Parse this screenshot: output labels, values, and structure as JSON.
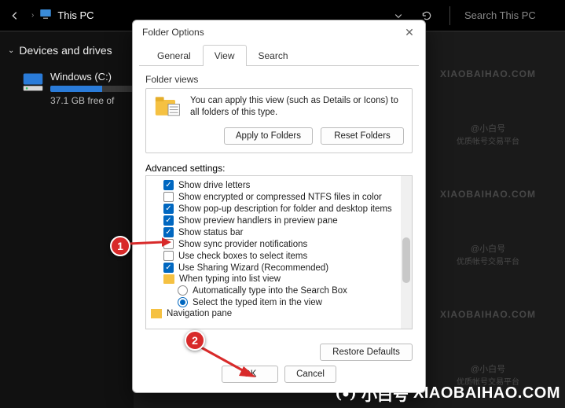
{
  "topbar": {
    "location": "This PC",
    "search_placeholder": "Search This PC"
  },
  "sidebar": {
    "section": "Devices and drives",
    "drive": {
      "name": "Windows (C:)",
      "sub": "37.1 GB free of",
      "fill_pct": 60
    }
  },
  "dialog": {
    "title": "Folder Options",
    "tabs": {
      "general": "General",
      "view": "View",
      "search": "Search"
    },
    "folder_views": {
      "heading": "Folder views",
      "text": "You can apply this view (such as Details or Icons) to all folders of this type.",
      "apply": "Apply to Folders",
      "reset": "Reset Folders"
    },
    "advanced": {
      "heading": "Advanced settings:",
      "items": [
        {
          "kind": "check",
          "checked": true,
          "label": "Show drive letters"
        },
        {
          "kind": "check",
          "checked": false,
          "label": "Show encrypted or compressed NTFS files in color"
        },
        {
          "kind": "check",
          "checked": true,
          "label": "Show pop-up description for folder and desktop items"
        },
        {
          "kind": "check",
          "checked": true,
          "label": "Show preview handlers in preview pane"
        },
        {
          "kind": "check",
          "checked": true,
          "label": "Show status bar"
        },
        {
          "kind": "check",
          "checked": false,
          "label": "Show sync provider notifications"
        },
        {
          "kind": "check",
          "checked": false,
          "label": "Use check boxes to select items"
        },
        {
          "kind": "check",
          "checked": true,
          "label": "Use Sharing Wizard (Recommended)"
        },
        {
          "kind": "folder",
          "label": "When typing into list view"
        },
        {
          "kind": "radio",
          "selected": false,
          "label": "Automatically type into the Search Box"
        },
        {
          "kind": "radio",
          "selected": true,
          "label": "Select the typed item in the view"
        },
        {
          "kind": "pane",
          "label": "Navigation pane"
        }
      ]
    },
    "restore": "Restore Defaults",
    "ok": "OK",
    "cancel": "Cancel"
  },
  "markers": {
    "m1": "1",
    "m2": "2"
  },
  "watermark": {
    "cn": "@小白号",
    "sub": "优质帐号交易平台",
    "url": "XIAOBAIHAO.COM",
    "banner_cn": "小白号"
  }
}
